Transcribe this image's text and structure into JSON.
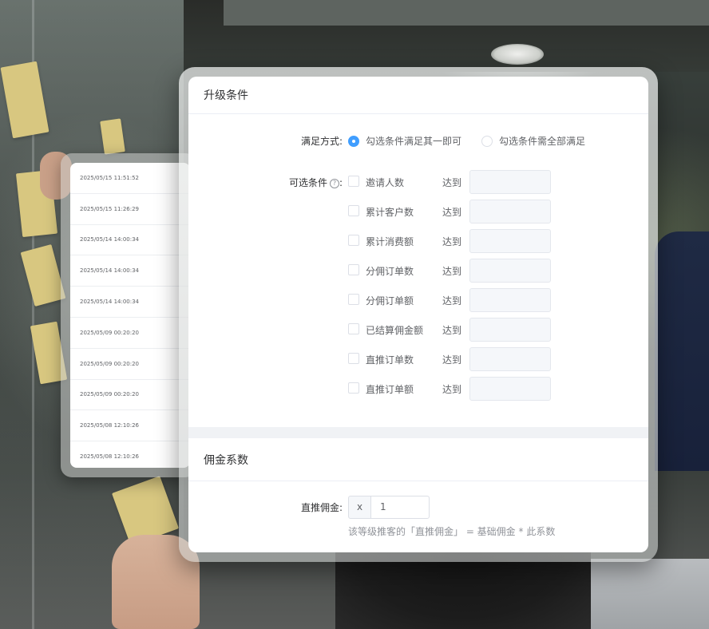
{
  "timestamps": [
    "2025/05/15 11:51:52",
    "2025/05/15 11:26:29",
    "2025/05/14 14:00:34",
    "2025/05/14 14:00:34",
    "2025/05/14 14:00:34",
    "2025/05/09 00:20:20",
    "2025/05/09 00:20:20",
    "2025/05/09 00:20:20",
    "2025/05/08 12:10:26",
    "2025/05/08 12:10:26"
  ],
  "upgrade": {
    "title": "升级条件",
    "mode_label": "满足方式:",
    "mode_options": [
      "勾选条件满足其一即可",
      "勾选条件需全部满足"
    ],
    "mode_selected": 0,
    "conditions_label": "可选条件",
    "help_icon": "?",
    "conditions_colon": ":",
    "reach_label": "达到",
    "conditions": [
      "邀请人数",
      "累计客户数",
      "累计消费额",
      "分佣订单数",
      "分佣订单额",
      "已结算佣金额",
      "直推订单数",
      "直推订单额"
    ]
  },
  "commission": {
    "title": "佣金系数",
    "direct_label": "直推佣金:",
    "prefix": "x",
    "value": "1",
    "hint": "该等级推客的「直推佣金」 = 基础佣金 * 此系数"
  },
  "colors": {
    "accent": "#409eff",
    "text_primary": "#303133",
    "text_regular": "#606266",
    "text_hint": "#909399"
  }
}
